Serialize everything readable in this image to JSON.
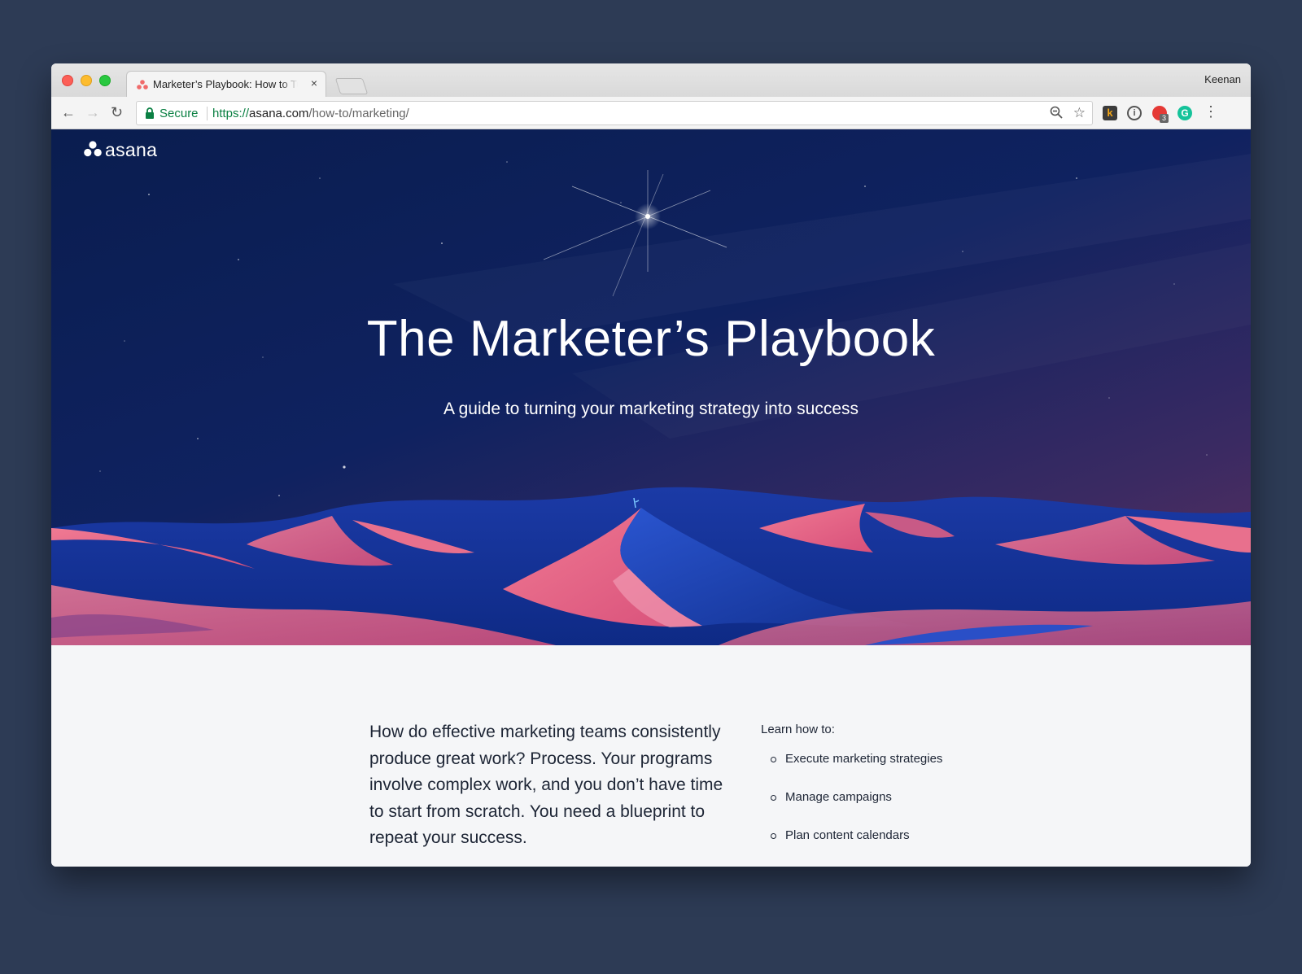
{
  "browser": {
    "tab_title": "Marketer’s Playbook: How to Turn Your Marketing Strategy into Success",
    "tab_close": "×",
    "profile_name": "Keenan",
    "secure_label": "Secure",
    "url_scheme": "https://",
    "url_host": "asana.com",
    "url_path": "/how-to/marketing/",
    "extension_badge_count": "3",
    "icons": [
      "back-arrow-icon",
      "forward-arrow-icon",
      "reload-icon",
      "lock-icon",
      "zoom-icon",
      "star-icon",
      "menu-icon"
    ]
  },
  "brand": {
    "logo_text": "asana",
    "logo_color": "#ffffff",
    "accent_pink": "#e86a86",
    "accent_blue": "#1d43b5"
  },
  "hero": {
    "title": "The Marketer’s Playbook",
    "subtitle": "A guide to turning your marketing strategy into success"
  },
  "content": {
    "intro": "How do effective marketing teams consistently produce great work? Process. Your programs involve complex work, and you don’t have time to start from scratch. You need a blueprint to repeat your success.",
    "learn_title": "Learn how to:",
    "learn_items": [
      "Execute marketing strategies",
      "Manage campaigns",
      "Plan content calendars"
    ]
  }
}
